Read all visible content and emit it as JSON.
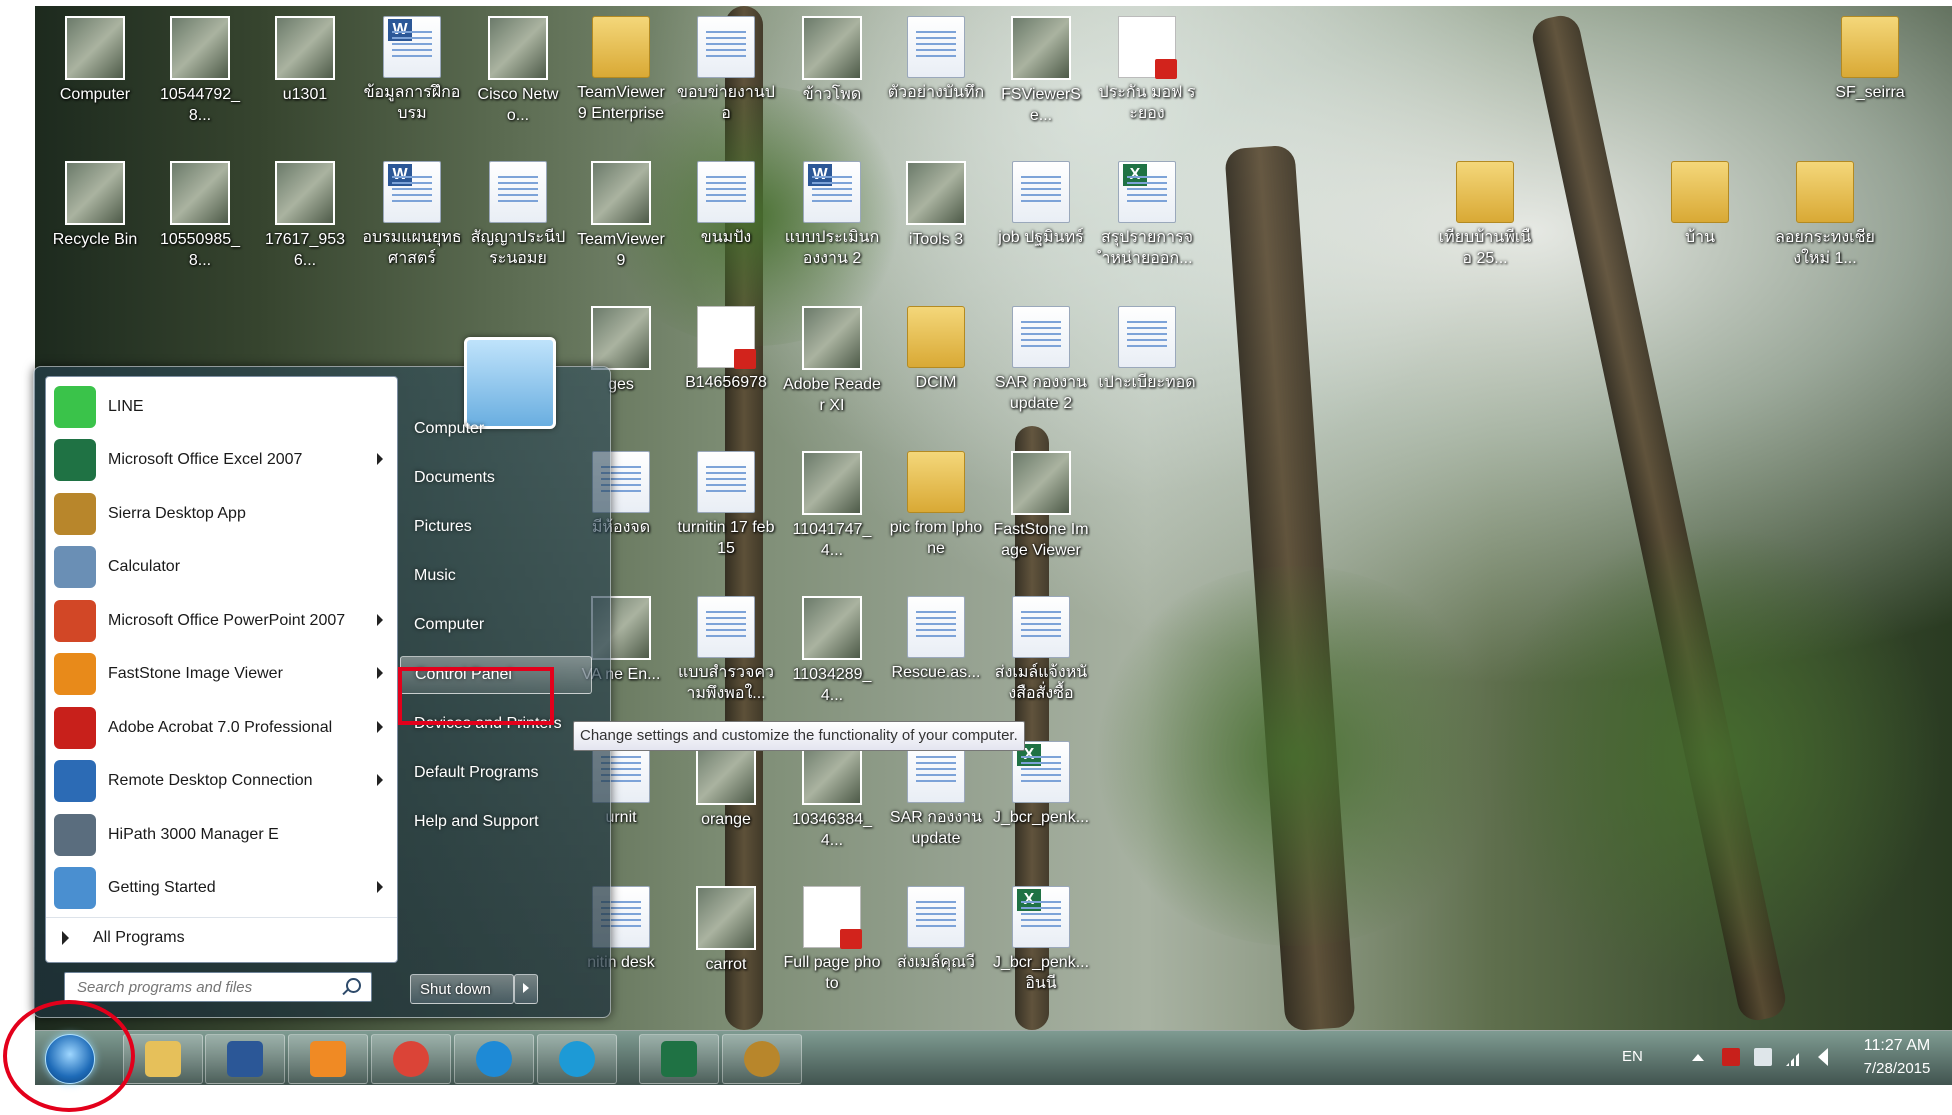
{
  "desktop": {
    "icons": [
      {
        "label": "Computer",
        "type": "computer"
      },
      {
        "label": "10544792_8...",
        "type": "photo"
      },
      {
        "label": "u1301",
        "type": "app"
      },
      {
        "label": "ข้อมูลการฝึกอบรม",
        "type": "word"
      },
      {
        "label": "Cisco Netwo...",
        "type": "app"
      },
      {
        "label": "TeamViewer 9 Enterprise",
        "type": "folder"
      },
      {
        "label": "ขอบข่ายงานปอ",
        "type": "doc"
      },
      {
        "label": "ข้าวโพด",
        "type": "photo"
      },
      {
        "label": "ตัวอย่างบันทึก",
        "type": "blank"
      },
      {
        "label": "FSViewerSe...",
        "type": "app"
      },
      {
        "label": "ประกัน มอฟ ระยอง",
        "type": "pdf"
      },
      {
        "label": "SF_seirra",
        "type": "folder"
      },
      {
        "label": "Recycle Bin",
        "type": "recycle"
      },
      {
        "label": "10550985_8...",
        "type": "photo"
      },
      {
        "label": "17617_9536...",
        "type": "photo"
      },
      {
        "label": "อบรมแผนยุทธศาสตร์",
        "type": "word"
      },
      {
        "label": "สัญญาประนีประนอมย",
        "type": "doc"
      },
      {
        "label": "TeamViewer 9",
        "type": "app"
      },
      {
        "label": "ขนมปัง",
        "type": "doc"
      },
      {
        "label": "แบบประเมินกองงาน 2",
        "type": "word"
      },
      {
        "label": "iTools 3",
        "type": "app"
      },
      {
        "label": "job ปฐมินทร์",
        "type": "doc"
      },
      {
        "label": "สรุปรายการจำหน่ายออก...",
        "type": "excel"
      },
      {
        "label": "เทียบบ้านพีเนือ 25...",
        "type": "folder"
      },
      {
        "label": "บ้าน",
        "type": "folder"
      },
      {
        "label": "ลอยกระทงเชียงใหม่ 1...",
        "type": "folder"
      },
      {
        "label": "ges",
        "type": "photo"
      },
      {
        "label": "B14656978",
        "type": "pdf"
      },
      {
        "label": "Adobe Reader XI",
        "type": "app"
      },
      {
        "label": "DCIM",
        "type": "folder"
      },
      {
        "label": "SAR กองงาน update 2",
        "type": "doc"
      },
      {
        "label": "เปาะเบียะทอด",
        "type": "doc"
      },
      {
        "label": "มีห้องจด",
        "type": "doc"
      },
      {
        "label": "turnitin 17 feb 15",
        "type": "doc"
      },
      {
        "label": "11041747_4...",
        "type": "photo"
      },
      {
        "label": "pic from Iphone",
        "type": "folder"
      },
      {
        "label": "FastStone Image Viewer",
        "type": "app"
      },
      {
        "label": "VA ne En...",
        "type": "app"
      },
      {
        "label": "แบบสำรวจความพึงพอใ...",
        "type": "doc"
      },
      {
        "label": "11034289_4...",
        "type": "photo"
      },
      {
        "label": "Rescue.as...",
        "type": "doc"
      },
      {
        "label": "ส่งเมล์แจ้งหนังสือสั่งซื้อ",
        "type": "doc"
      },
      {
        "label": "urnit",
        "type": "doc"
      },
      {
        "label": "orange",
        "type": "photo"
      },
      {
        "label": "10346384_4...",
        "type": "photo"
      },
      {
        "label": "SAR กองงาน update",
        "type": "doc"
      },
      {
        "label": "J_bcr_penk...",
        "type": "excel"
      },
      {
        "label": "nitin desk",
        "type": "doc"
      },
      {
        "label": "carrot",
        "type": "photo"
      },
      {
        "label": "Full page photo",
        "type": "pdf"
      },
      {
        "label": "ส่งเมล์คุณวี",
        "type": "doc"
      },
      {
        "label": "J_bcr_penk... อินนี",
        "type": "excel"
      }
    ]
  },
  "start_menu": {
    "programs": [
      {
        "label": "LINE",
        "icon": "line-icon",
        "color": "#3ac34a",
        "submenu": false
      },
      {
        "label": "Microsoft Office Excel 2007",
        "icon": "excel-icon",
        "color": "#1f7244",
        "submenu": true
      },
      {
        "label": "Sierra Desktop App",
        "icon": "sierra-icon",
        "color": "#b8862b",
        "submenu": false
      },
      {
        "label": "Calculator",
        "icon": "calculator-icon",
        "color": "#6a8fb5",
        "submenu": false
      },
      {
        "label": "Microsoft Office PowerPoint 2007",
        "icon": "powerpoint-icon",
        "color": "#d24726",
        "submenu": true
      },
      {
        "label": "FastStone Image Viewer",
        "icon": "eye-icon",
        "color": "#e88a1a",
        "submenu": true
      },
      {
        "label": "Adobe Acrobat 7.0 Professional",
        "icon": "acrobat-icon",
        "color": "#c8201b",
        "submenu": true
      },
      {
        "label": "Remote Desktop Connection",
        "icon": "remote-desktop-icon",
        "color": "#2c6bb5",
        "submenu": true
      },
      {
        "label": "HiPath 3000 Manager E",
        "icon": "hipath-icon",
        "color": "#5a6d7e",
        "submenu": false
      },
      {
        "label": "Getting Started",
        "icon": "getting-started-icon",
        "color": "#4a8fd0",
        "submenu": true
      }
    ],
    "all_programs": "All Programs",
    "search_placeholder": "Search programs and files",
    "right_links": [
      "Computer",
      "Documents",
      "Pictures",
      "Music",
      "Computer",
      "Control Panel",
      "Devices and Printers",
      "Default Programs",
      "Help and Support"
    ],
    "highlighted_link": "Control Panel",
    "shutdown": "Shut down",
    "tooltip": "Change settings and customize the functionality of your computer."
  },
  "taskbar": {
    "pinned": [
      {
        "name": "explorer-icon",
        "color": "#e6c05a"
      },
      {
        "name": "word-icon",
        "color": "#2b5797"
      },
      {
        "name": "media-player-icon",
        "color": "#f08a24"
      },
      {
        "name": "chrome-icon",
        "color": "#db4437"
      },
      {
        "name": "internet-explorer-icon",
        "color": "#1e8ad6"
      },
      {
        "name": "itools-icon",
        "color": "#1d9ad6"
      },
      {
        "name": "excel-icon",
        "color": "#1f7244"
      },
      {
        "name": "sierra-icon",
        "color": "#b8862b"
      }
    ],
    "tray": {
      "language": "EN",
      "time": "11:27 AM",
      "date": "7/28/2015"
    }
  }
}
